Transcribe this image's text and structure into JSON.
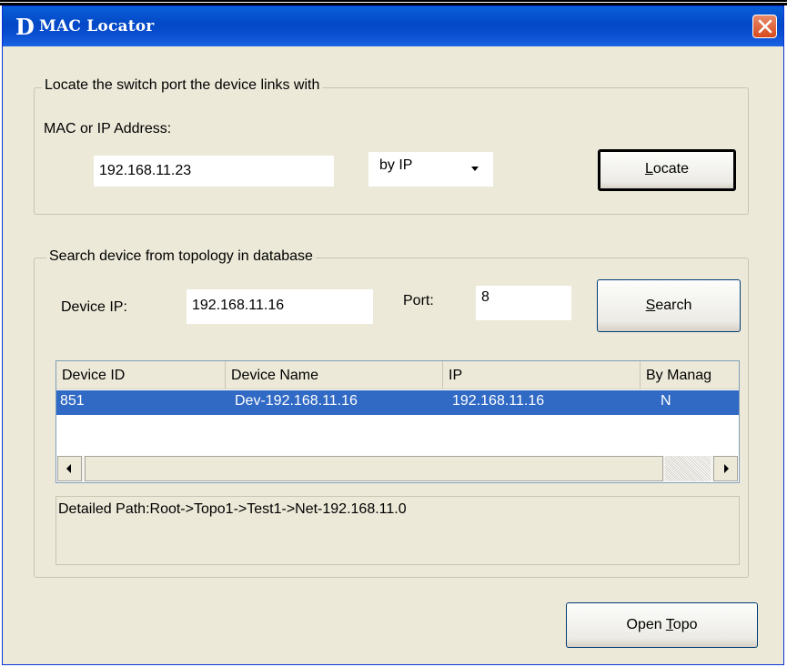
{
  "window": {
    "logo_letter": "D",
    "title": "MAC Locator"
  },
  "locate_group": {
    "legend": "Locate the switch port the device links with",
    "address_label": "MAC or IP Address:",
    "address_value": "192.168.11.23",
    "mode_selected": "by IP",
    "locate_button": "Locate"
  },
  "search_group": {
    "legend": "Search device from topology in database",
    "device_ip_label": "Device IP:",
    "device_ip_value": "192.168.11.16",
    "port_label": "Port:",
    "port_value": "8",
    "search_button": "Search",
    "table": {
      "columns": [
        "Device ID",
        "Device Name",
        "IP",
        "By Manag"
      ],
      "rows": [
        [
          "851",
          "Dev-192.168.11.16",
          "192.168.11.16",
          "N"
        ]
      ]
    },
    "detailed_path": "Detailed Path:Root->Topo1->Test1->Net-192.168.11.0"
  },
  "footer": {
    "open_topo_button": "Open Topo"
  },
  "colors": {
    "titlebar": "#0348c6",
    "selection": "#316ac5",
    "dialog_bg": "#ece9d8",
    "close_button": "#d64a1c"
  }
}
